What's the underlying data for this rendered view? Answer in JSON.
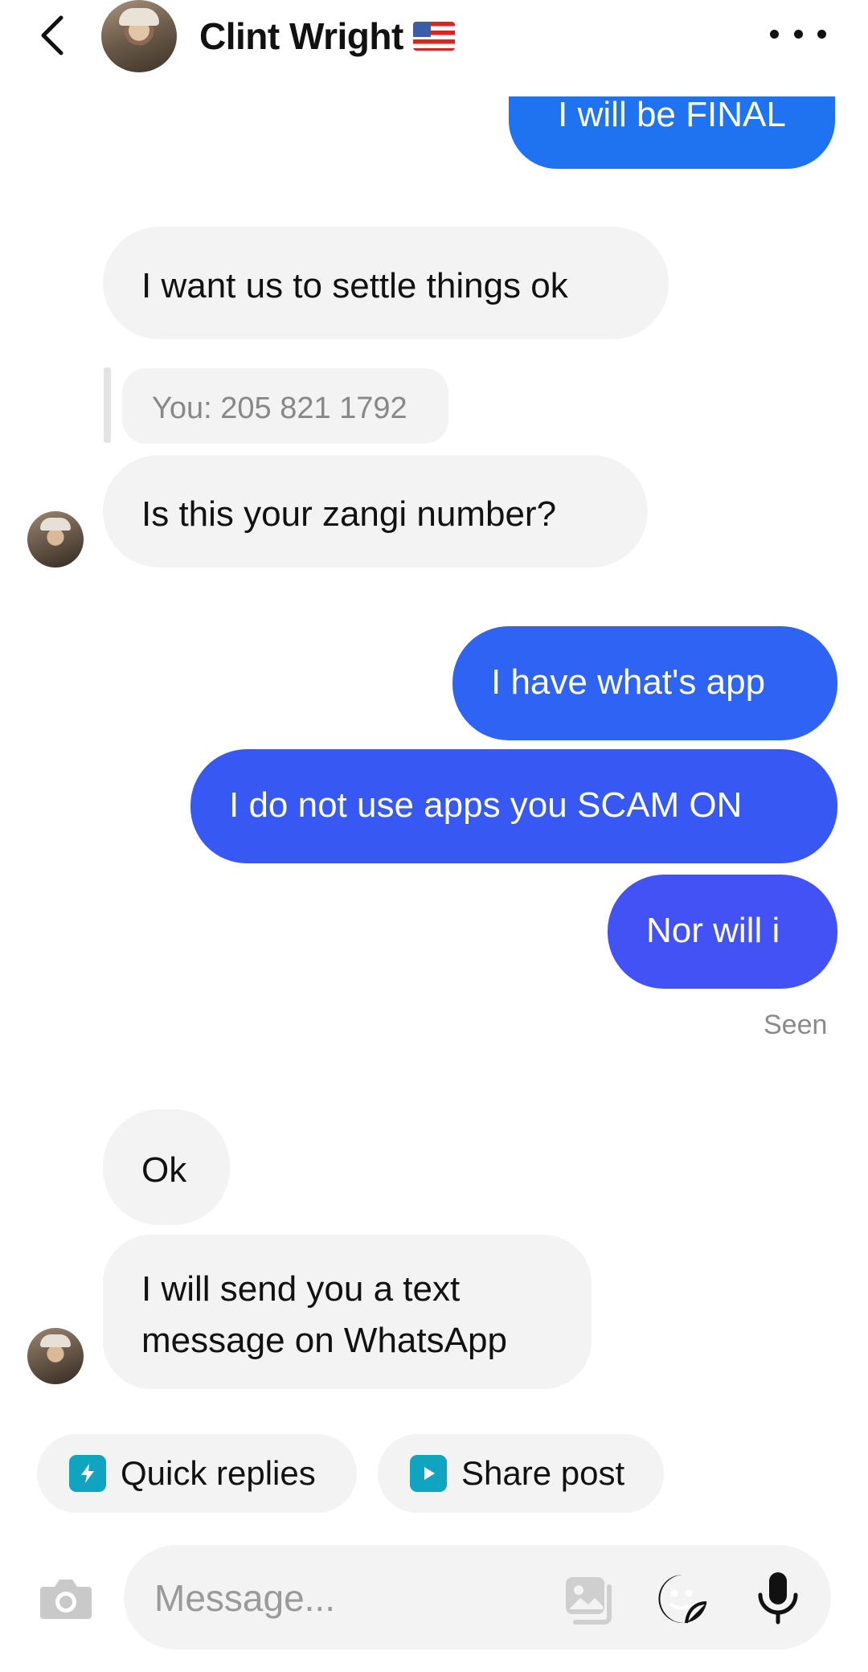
{
  "header": {
    "contact_name": "Clint Wright",
    "flag": "🇺🇸"
  },
  "messages": [
    {
      "dir": "out",
      "text": "I will be FINAL"
    },
    {
      "dir": "in",
      "text": "I want us to settle things ok"
    },
    {
      "dir": "in",
      "quote": "You: 205 821 1792",
      "text": "Is this your zangi number?"
    },
    {
      "dir": "out",
      "text": "I have what's app"
    },
    {
      "dir": "out",
      "text": "I do not use apps you SCAM ON"
    },
    {
      "dir": "out",
      "text": "Nor will i"
    },
    {
      "dir": "in",
      "text": "Ok"
    },
    {
      "dir": "in",
      "text": "I will send you a text message on WhatsApp"
    }
  ],
  "status": {
    "seen": "Seen"
  },
  "chips": {
    "quick_replies": "Quick replies",
    "share_post": "Share post"
  },
  "composer": {
    "placeholder": "Message..."
  },
  "icons": {
    "back": "chevron-left-icon",
    "more": "more-dots-icon",
    "camera": "camera-icon",
    "gallery": "gallery-icon",
    "sticker": "sticker-icon",
    "mic": "microphone-icon",
    "quick": "lightning-bubble-icon",
    "share": "play-square-icon"
  },
  "colors": {
    "chip_icon": "#0fa5c1",
    "outgoing_1": "#1f73f1",
    "outgoing_2": "#2f63f3",
    "outgoing_3": "#3758f3",
    "outgoing_4": "#4352f5",
    "incoming": "#f3f3f3"
  }
}
